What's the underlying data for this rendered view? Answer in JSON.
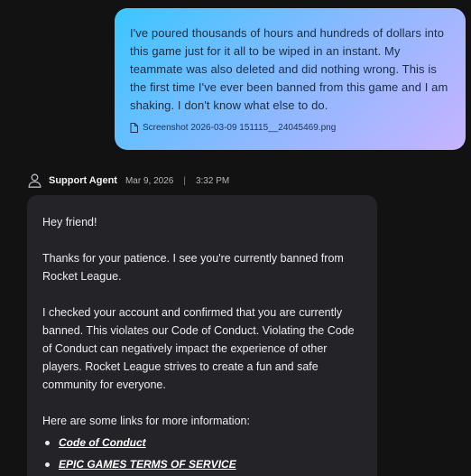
{
  "user_message": {
    "text": "I've poured thousands of hours and hundreds of dollars into this game just for it all to be wiped in an instant. My teammate was also deleted and did nothing wrong. This is the first time I've ever been banned from this game and I am shaking. I don't know what else to do.",
    "attachment_name": "Screenshot 2026-03-09 151115__24045469.png"
  },
  "agent_header": {
    "name": "Support Agent",
    "date": "Mar 9, 2026",
    "separator": "|",
    "time": "3:32 PM"
  },
  "agent_message": {
    "greeting": "Hey friend!",
    "paragraph_1": "Thanks for your patience. I see you're currently banned from Rocket League.",
    "paragraph_2": "I checked your account and confirmed that you are currently banned. This violates our Code of Conduct. Violating the Code of Conduct can negatively impact the experience of other players. Rocket League strives to create a fun and safe community for everyone.",
    "links_intro": "Here are some links for more information:",
    "links": [
      {
        "label": "Code of Conduct"
      },
      {
        "label": "EPIC GAMES TERMS OF SERVICE"
      }
    ]
  },
  "colors": {
    "background": "#121212",
    "agent_bubble": "#242428",
    "user_gradient_start": "#3bc6ff",
    "user_gradient_end": "#c7b3ff"
  }
}
